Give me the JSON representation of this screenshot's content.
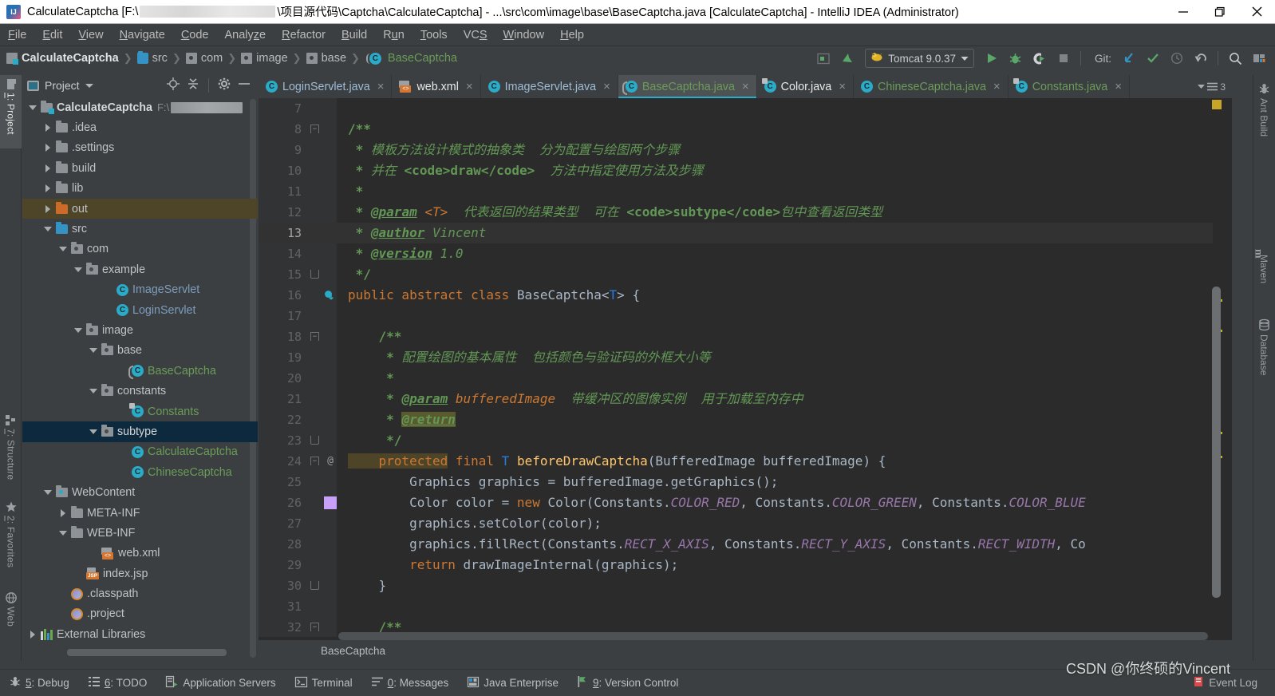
{
  "window": {
    "title_prefix": "CalculateCaptcha [F:\\",
    "title_suffix": "\\项目源代码\\Captcha\\CalculateCaptcha] - ...\\src\\com\\image\\base\\BaseCaptcha.java [CalculateCaptcha] - IntelliJ IDEA (Administrator)",
    "app_icon": "intellij-idea-icon",
    "controls": {
      "minimize": "minimize-icon",
      "maximize": "restore-icon",
      "close": "close-icon"
    }
  },
  "menubar": {
    "items": [
      {
        "label": "File",
        "mnemonic": "F"
      },
      {
        "label": "Edit",
        "mnemonic": "E"
      },
      {
        "label": "View",
        "mnemonic": "V"
      },
      {
        "label": "Navigate",
        "mnemonic": "N"
      },
      {
        "label": "Code",
        "mnemonic": "C"
      },
      {
        "label": "Analyze",
        "mnemonic": "z"
      },
      {
        "label": "Refactor",
        "mnemonic": "R"
      },
      {
        "label": "Build",
        "mnemonic": "B"
      },
      {
        "label": "Run",
        "mnemonic": "u"
      },
      {
        "label": "Tools",
        "mnemonic": "T"
      },
      {
        "label": "VCS",
        "mnemonic": "S"
      },
      {
        "label": "Window",
        "mnemonic": "W"
      },
      {
        "label": "Help",
        "mnemonic": "H"
      }
    ]
  },
  "navbar": {
    "breadcrumbs": [
      {
        "label": "CalculateCaptcha",
        "icon": "module-icon",
        "bold": true,
        "color": "#e0e3e4"
      },
      {
        "label": "src",
        "icon": "source-folder-icon",
        "color": "#b8bcbe"
      },
      {
        "label": "com",
        "icon": "package-icon",
        "color": "#b8bcbe"
      },
      {
        "label": "image",
        "icon": "package-icon",
        "color": "#b8bcbe"
      },
      {
        "label": "base",
        "icon": "package-icon",
        "color": "#b8bcbe"
      },
      {
        "label": "BaseCaptcha",
        "icon": "abstract-class-icon",
        "color": "#6a9c59"
      }
    ],
    "separator": "❯",
    "run_config": {
      "label": "Tomcat 9.0.37",
      "icon": "tomcat-icon",
      "dropdown": "chevron-down-icon"
    },
    "git_label": "Git:",
    "buttons": [
      "select-in-icon",
      "make-project-icon",
      "run-button",
      "debug-button",
      "run-with-coverage-button",
      "stop-button",
      "git-update-button",
      "git-commit-button",
      "git-history-button",
      "git-revert-button",
      "search-everywhere-button",
      "settings-button"
    ]
  },
  "left_tool_strip": {
    "tabs": [
      {
        "label": "1: Project",
        "mnemonic": "1",
        "icon": "project-icon",
        "active": true
      },
      {
        "label": "7: Structure",
        "mnemonic": "7",
        "icon": "structure-icon",
        "active": false
      },
      {
        "label": "2: Favorites",
        "mnemonic": "2",
        "icon": "star-icon",
        "active": false
      },
      {
        "label": "Web",
        "mnemonic": "",
        "icon": "web-icon",
        "active": false
      }
    ]
  },
  "right_tool_strip": {
    "tabs": [
      {
        "label": "Ant Build",
        "icon": "ant-icon"
      },
      {
        "label": "Maven",
        "icon": "maven-icon"
      },
      {
        "label": "Database",
        "icon": "database-icon"
      }
    ]
  },
  "project_panel": {
    "header": {
      "title": "Project",
      "dropdown": "chevron-down-icon",
      "actions": [
        "locate-icon",
        "collapse-all-icon",
        "settings-gear-icon",
        "hide-icon"
      ]
    },
    "tree": [
      {
        "label": "CalculateCaptcha",
        "sub": "F:\\",
        "redacted": true,
        "indent": 0,
        "arrow": "down",
        "icon": "module-folder-icon",
        "bold": true,
        "color": "#d5d8d9",
        "state": ""
      },
      {
        "label": ".idea",
        "sub": "",
        "indent": 1,
        "arrow": "right",
        "icon": "folder-icon",
        "color": "#bfc3c5",
        "state": ""
      },
      {
        "label": ".settings",
        "sub": "",
        "indent": 1,
        "arrow": "right",
        "icon": "folder-icon",
        "color": "#bfc3c5",
        "state": ""
      },
      {
        "label": "build",
        "sub": "",
        "indent": 1,
        "arrow": "right",
        "icon": "folder-icon",
        "color": "#bfc3c5",
        "state": ""
      },
      {
        "label": "lib",
        "sub": "",
        "indent": 1,
        "arrow": "right",
        "icon": "folder-icon",
        "color": "#bfc3c5",
        "state": ""
      },
      {
        "label": "out",
        "sub": "",
        "indent": 1,
        "arrow": "right",
        "icon": "excluded-folder-icon",
        "color": "#bfc3c5",
        "state": "highlighted"
      },
      {
        "label": "src",
        "sub": "",
        "indent": 1,
        "arrow": "down",
        "icon": "source-folder-icon",
        "color": "#bfc3c5",
        "state": ""
      },
      {
        "label": "com",
        "sub": "",
        "indent": 2,
        "arrow": "down",
        "icon": "package-icon",
        "color": "#bfc3c5",
        "state": ""
      },
      {
        "label": "example",
        "sub": "",
        "indent": 3,
        "arrow": "down",
        "icon": "package-icon",
        "color": "#bfc3c5",
        "state": ""
      },
      {
        "label": "ImageServlet",
        "sub": "",
        "indent": 5,
        "arrow": "none",
        "icon": "class-icon",
        "color": "#7c9cbd",
        "state": ""
      },
      {
        "label": "LoginServlet",
        "sub": "",
        "indent": 5,
        "arrow": "none",
        "icon": "class-icon",
        "color": "#7c9cbd",
        "state": ""
      },
      {
        "label": "image",
        "sub": "",
        "indent": 3,
        "arrow": "down",
        "icon": "package-icon",
        "color": "#bfc3c5",
        "state": ""
      },
      {
        "label": "base",
        "sub": "",
        "indent": 4,
        "arrow": "down",
        "icon": "package-icon",
        "color": "#bfc3c5",
        "state": ""
      },
      {
        "label": "BaseCaptcha",
        "sub": "",
        "indent": 6,
        "arrow": "none",
        "icon": "abstract-class-icon",
        "color": "#6a9c59",
        "state": ""
      },
      {
        "label": "constants",
        "sub": "",
        "indent": 4,
        "arrow": "down",
        "icon": "package-icon",
        "color": "#bfc3c5",
        "state": ""
      },
      {
        "label": "Constants",
        "sub": "",
        "indent": 6,
        "arrow": "none",
        "icon": "final-class-icon",
        "color": "#6a9c59",
        "state": ""
      },
      {
        "label": "subtype",
        "sub": "",
        "indent": 4,
        "arrow": "down",
        "icon": "package-icon",
        "color": "#d5d8d9",
        "state": "selected"
      },
      {
        "label": "CalculateCaptcha",
        "sub": "",
        "indent": 6,
        "arrow": "none",
        "icon": "class-icon",
        "color": "#6a9c59",
        "state": ""
      },
      {
        "label": "ChineseCaptcha",
        "sub": "",
        "indent": 6,
        "arrow": "none",
        "icon": "class-icon",
        "color": "#6a9c59",
        "state": ""
      },
      {
        "label": "WebContent",
        "sub": "",
        "indent": 1,
        "arrow": "down",
        "icon": "web-package-icon",
        "color": "#bfc3c5",
        "state": ""
      },
      {
        "label": "META-INF",
        "sub": "",
        "indent": 2,
        "arrow": "right",
        "icon": "folder-icon",
        "color": "#bfc3c5",
        "state": ""
      },
      {
        "label": "WEB-INF",
        "sub": "",
        "indent": 2,
        "arrow": "down",
        "icon": "folder-icon",
        "color": "#bfc3c5",
        "state": ""
      },
      {
        "label": "web.xml",
        "sub": "",
        "indent": 4,
        "arrow": "none",
        "icon": "xml-file-icon",
        "color": "#bfc3c5",
        "state": ""
      },
      {
        "label": "index.jsp",
        "sub": "",
        "indent": 3,
        "arrow": "none",
        "icon": "jsp-file-icon",
        "color": "#bfc3c5",
        "state": ""
      },
      {
        "label": ".classpath",
        "sub": "",
        "indent": 2,
        "arrow": "none",
        "icon": "eclipse-file-icon",
        "color": "#bfc3c5",
        "state": ""
      },
      {
        "label": ".project",
        "sub": "",
        "indent": 2,
        "arrow": "none",
        "icon": "eclipse-file-icon",
        "color": "#bfc3c5",
        "state": ""
      },
      {
        "label": "External Libraries",
        "sub": "",
        "indent": 0,
        "arrow": "right",
        "icon": "libraries-icon",
        "color": "#bfc3c5",
        "state": ""
      }
    ]
  },
  "editor": {
    "tabs": [
      {
        "label": "LoginServlet.java",
        "icon": "class-icon",
        "color": "blue",
        "active": false
      },
      {
        "label": "web.xml",
        "icon": "xml-file-icon",
        "color": "white",
        "active": false
      },
      {
        "label": "ImageServlet.java",
        "icon": "class-icon",
        "color": "blue",
        "active": false
      },
      {
        "label": "BaseCaptcha.java",
        "icon": "abstract-class-icon",
        "color": "green",
        "active": true
      },
      {
        "label": "Color.java",
        "icon": "final-class-icon",
        "color": "white",
        "active": false
      },
      {
        "label": "ChineseCaptcha.java",
        "icon": "class-icon",
        "color": "green",
        "active": false
      },
      {
        "label": "Constants.java",
        "icon": "final-class-icon",
        "color": "green",
        "active": false
      }
    ],
    "tab_close_glyph": "×",
    "tab_overflow_count": "3",
    "current_line": 13,
    "breadcrumb_bottom": "BaseCaptcha",
    "lines": [
      {
        "no": 7,
        "fold": "none",
        "annot": "",
        "tokens": []
      },
      {
        "no": 8,
        "fold": "top",
        "annot": "",
        "tokens": [
          {
            "t": "/**",
            "c": "c-doc-b"
          }
        ],
        "indent": 0
      },
      {
        "no": 9,
        "fold": "none",
        "annot": "",
        "tokens": [
          {
            "t": " * ",
            "c": "c-doc-b"
          },
          {
            "t": "模板方法设计模式的抽象类  分为配置与绘图两个步骤",
            "c": "c-doc"
          }
        ]
      },
      {
        "no": 10,
        "fold": "none",
        "annot": "",
        "tokens": [
          {
            "t": " * ",
            "c": "c-doc-b"
          },
          {
            "t": "并在 ",
            "c": "c-doc"
          },
          {
            "t": "<code>draw</code>",
            "c": "c-doc-b"
          },
          {
            "t": "  方法中指定使用方法及步骤",
            "c": "c-doc"
          }
        ]
      },
      {
        "no": 11,
        "fold": "none",
        "annot": "",
        "tokens": [
          {
            "t": " * ",
            "c": "c-doc-b"
          }
        ]
      },
      {
        "no": 12,
        "fold": "none",
        "annot": "",
        "tokens": [
          {
            "t": " * ",
            "c": "c-doc-b"
          },
          {
            "t": "@param",
            "c": "c-tag"
          },
          {
            "t": " ",
            "c": "c-doc"
          },
          {
            "t": "<T>",
            "c": "c-param"
          },
          {
            "t": "  代表返回的结果类型  可在 ",
            "c": "c-doc"
          },
          {
            "t": "<code>subtype</code>",
            "c": "c-doc-b"
          },
          {
            "t": "包中查看返回类型",
            "c": "c-doc"
          }
        ]
      },
      {
        "no": 13,
        "fold": "none",
        "annot": "",
        "current": true,
        "tokens": [
          {
            "t": " * ",
            "c": "c-doc-b"
          },
          {
            "t": "@author",
            "c": "c-tag"
          },
          {
            "t": " Vincent",
            "c": "c-doc"
          }
        ]
      },
      {
        "no": 14,
        "fold": "none",
        "annot": "",
        "tokens": [
          {
            "t": " * ",
            "c": "c-doc-b"
          },
          {
            "t": "@version",
            "c": "c-tag"
          },
          {
            "t": " 1.0",
            "c": "c-doc"
          }
        ]
      },
      {
        "no": 15,
        "fold": "bot",
        "annot": "",
        "tokens": [
          {
            "t": " */",
            "c": "c-doc-b"
          }
        ]
      },
      {
        "no": 16,
        "fold": "none",
        "annot": "implemented-marker",
        "tokens": [
          {
            "t": "public abstract class ",
            "c": "c-kw"
          },
          {
            "t": "BaseCaptcha",
            "c": "c-type"
          },
          {
            "t": "<",
            "c": "c-white"
          },
          {
            "t": "T",
            "c": "c-gen"
          },
          {
            "t": "> {",
            "c": "c-white"
          }
        ]
      },
      {
        "no": 17,
        "fold": "none",
        "annot": "",
        "tokens": []
      },
      {
        "no": 18,
        "fold": "top",
        "annot": "",
        "tokens": [
          {
            "t": "    /**",
            "c": "c-doc-b"
          }
        ]
      },
      {
        "no": 19,
        "fold": "none",
        "annot": "",
        "tokens": [
          {
            "t": "     * ",
            "c": "c-doc-b"
          },
          {
            "t": "配置绘图的基本属性  包括颜色与验证码的外框大小等",
            "c": "c-doc"
          }
        ]
      },
      {
        "no": 20,
        "fold": "none",
        "annot": "",
        "tokens": [
          {
            "t": "     * ",
            "c": "c-doc-b"
          }
        ]
      },
      {
        "no": 21,
        "fold": "none",
        "annot": "",
        "tokens": [
          {
            "t": "     * ",
            "c": "c-doc-b"
          },
          {
            "t": "@param",
            "c": "c-tag"
          },
          {
            "t": " ",
            "c": "c-doc"
          },
          {
            "t": "bufferedImage",
            "c": "c-param"
          },
          {
            "t": "  带缓冲区的图像实例  用于加载至内存中",
            "c": "c-doc"
          }
        ]
      },
      {
        "no": 22,
        "fold": "none",
        "annot": "",
        "tokens": [
          {
            "t": "     * ",
            "c": "c-doc-b"
          },
          {
            "t": "@return",
            "c": "c-retmark"
          }
        ]
      },
      {
        "no": 23,
        "fold": "bot",
        "annot": "",
        "tokens": [
          {
            "t": "     */",
            "c": "c-doc-b"
          }
        ]
      },
      {
        "no": 24,
        "fold": "top",
        "annot": "@",
        "tokens": [
          {
            "t": "    protected",
            "c": "c-kw c-hl"
          },
          {
            "t": " final ",
            "c": "c-kw"
          },
          {
            "t": "T",
            "c": "c-gen"
          },
          {
            "t": " ",
            "c": "c-white"
          },
          {
            "t": "beforeDrawCaptcha",
            "c": "c-fn"
          },
          {
            "t": "(BufferedImage bufferedImage) {",
            "c": "c-white"
          }
        ]
      },
      {
        "no": 25,
        "fold": "none",
        "annot": "",
        "tokens": [
          {
            "t": "        Graphics graphics = bufferedImage.getGraphics();",
            "c": "c-white"
          }
        ]
      },
      {
        "no": 26,
        "fold": "none",
        "annot": "color-swatch",
        "swatch": "#c9a0f7",
        "tokens": [
          {
            "t": "        Color color = ",
            "c": "c-white"
          },
          {
            "t": "new",
            "c": "c-kw"
          },
          {
            "t": " Color(Constants.",
            "c": "c-white"
          },
          {
            "t": "COLOR_RED",
            "c": "c-static"
          },
          {
            "t": ", Constants.",
            "c": "c-white"
          },
          {
            "t": "COLOR_GREEN",
            "c": "c-static"
          },
          {
            "t": ", Constants.",
            "c": "c-white"
          },
          {
            "t": "COLOR_BLUE",
            "c": "c-static"
          }
        ]
      },
      {
        "no": 27,
        "fold": "none",
        "annot": "",
        "tokens": [
          {
            "t": "        graphics.setColor(color);",
            "c": "c-white"
          }
        ]
      },
      {
        "no": 28,
        "fold": "none",
        "annot": "",
        "tokens": [
          {
            "t": "        graphics.fillRect(Constants.",
            "c": "c-white"
          },
          {
            "t": "RECT_X_AXIS",
            "c": "c-static"
          },
          {
            "t": ", Constants.",
            "c": "c-white"
          },
          {
            "t": "RECT_Y_AXIS",
            "c": "c-static"
          },
          {
            "t": ", Constants.",
            "c": "c-white"
          },
          {
            "t": "RECT_WIDTH",
            "c": "c-static"
          },
          {
            "t": ", Co",
            "c": "c-white"
          }
        ]
      },
      {
        "no": 29,
        "fold": "none",
        "annot": "",
        "tokens": [
          {
            "t": "        return",
            "c": "c-kw"
          },
          {
            "t": " drawImageInternal(graphics);",
            "c": "c-white"
          }
        ]
      },
      {
        "no": 30,
        "fold": "bot",
        "annot": "",
        "tokens": [
          {
            "t": "    }",
            "c": "c-white"
          }
        ]
      },
      {
        "no": 31,
        "fold": "none",
        "annot": "",
        "tokens": []
      },
      {
        "no": 32,
        "fold": "top",
        "annot": "",
        "tokens": [
          {
            "t": "    /**",
            "c": "c-doc-b"
          }
        ]
      }
    ]
  },
  "statusbar": {
    "items": [
      {
        "label": "5: Debug",
        "mnemonic": "5",
        "icon": "debug-icon"
      },
      {
        "label": "6: TODO",
        "mnemonic": "6",
        "icon": "todo-icon"
      },
      {
        "label": "Application Servers",
        "mnemonic": "",
        "icon": "app-servers-icon"
      },
      {
        "label": "Terminal",
        "mnemonic": "",
        "icon": "terminal-icon"
      },
      {
        "label": "0: Messages",
        "mnemonic": "0",
        "icon": "messages-icon"
      },
      {
        "label": "Java Enterprise",
        "mnemonic": "",
        "icon": "java-ee-icon"
      },
      {
        "label": "9: Version Control",
        "mnemonic": "9",
        "icon": "vcs-icon"
      }
    ],
    "event_log": {
      "label": "Event Log",
      "icon": "event-log-icon"
    }
  },
  "watermark": "CSDN @你终硕的Vincent",
  "colors": {
    "accent": "#2aacc8",
    "editor_bg": "#2b2b2b",
    "panel_bg": "#3c3f41",
    "gutter_bg": "#313335",
    "selection": "#0d293e",
    "doc_comment": "#629755",
    "keyword": "#cc7832",
    "static_field": "#9876aa",
    "method": "#ffc66d",
    "generic": "#287bde",
    "text": "#a9b7c6",
    "highlight_row": "#4e4528"
  }
}
